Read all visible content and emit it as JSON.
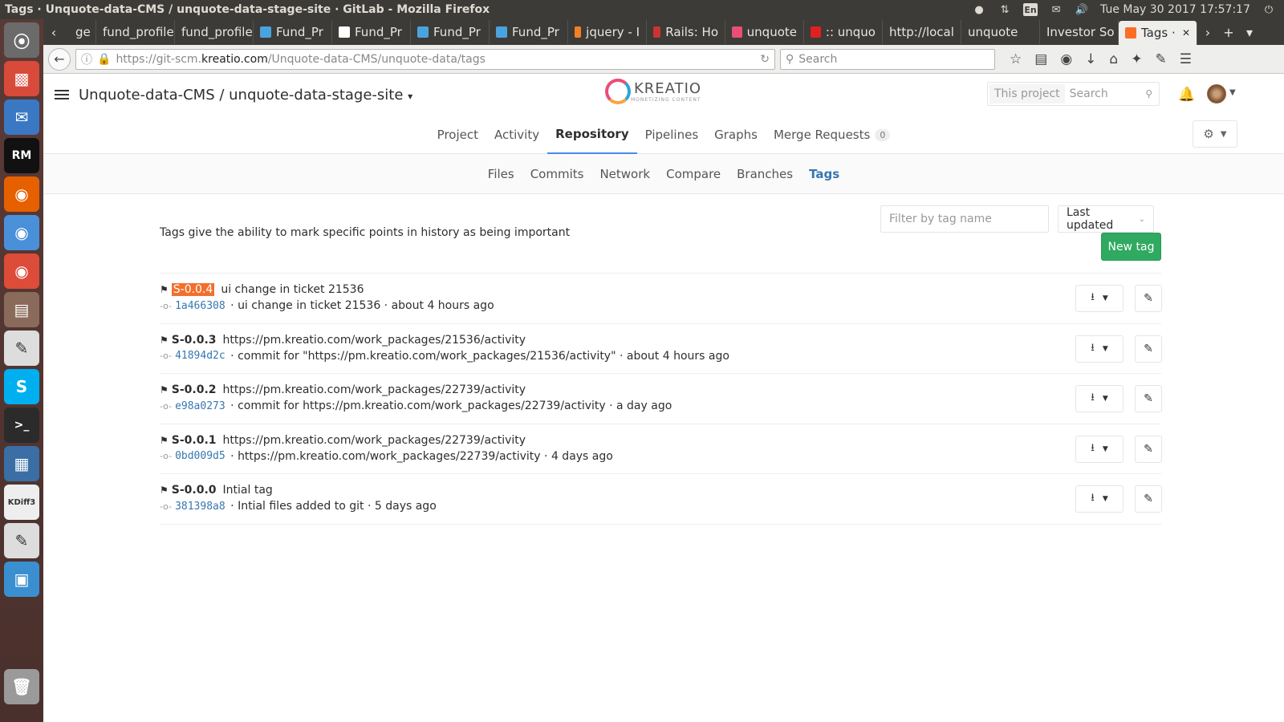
{
  "os": {
    "window_title": "Tags · Unquote-data-CMS / unquote-data-stage-site · GitLab - Mozilla Firefox",
    "lang": "En",
    "datetime": "Tue May 30 2017 17:57:17"
  },
  "browser": {
    "tabs": [
      {
        "label": "ge",
        "fav": "#888"
      },
      {
        "label": "fund_profile",
        "fav": ""
      },
      {
        "label": "fund_profile",
        "fav": ""
      },
      {
        "label": "Fund_Pr",
        "fav": "#4aa3df"
      },
      {
        "label": "Fund_Pr",
        "fav": "#ffffff"
      },
      {
        "label": "Fund_Pr",
        "fav": "#4aa3df"
      },
      {
        "label": "Fund_Pr",
        "fav": "#4aa3df"
      },
      {
        "label": "jquery - I",
        "fav": "#f48024"
      },
      {
        "label": "Rails: Ho",
        "fav": "#cc3333"
      },
      {
        "label": "unquote",
        "fav": "#e94e77"
      },
      {
        "label": ":: unquo",
        "fav": "#e02020"
      },
      {
        "label": "http://local",
        "fav": ""
      },
      {
        "label": "unquote",
        "fav": ""
      },
      {
        "label": "Investor So",
        "fav": ""
      },
      {
        "label": "Tags ·",
        "fav": "#fc6d26"
      }
    ],
    "url_prefix": "https://git-scm.",
    "url_host": "kreatio.com",
    "url_path": "/Unquote-data-CMS/unquote-data/tags",
    "search_placeholder": "Search"
  },
  "header": {
    "project_path": "Unquote-data-CMS / unquote-data-stage-site",
    "brand": "KREATIO",
    "tagline": "MONETIZING CONTENT",
    "search_scope": "This project",
    "search_placeholder": "Search"
  },
  "primary_nav": {
    "items": [
      "Project",
      "Activity",
      "Repository",
      "Pipelines",
      "Graphs",
      "Merge Requests"
    ],
    "merge_count": "0"
  },
  "secondary_nav": {
    "items": [
      "Files",
      "Commits",
      "Network",
      "Compare",
      "Branches",
      "Tags"
    ]
  },
  "tags_page": {
    "intro": "Tags give the ability to mark specific points in history as being important",
    "filter_placeholder": "Filter by tag name",
    "sort_label": "Last updated",
    "new_tag_label": "New tag",
    "tags": [
      {
        "name": "S-0.0.4",
        "message": "ui change in ticket 21536",
        "sha": "1a466308",
        "commit_msg": "ui change in ticket 21536",
        "time": "about 4 hours ago"
      },
      {
        "name": "S-0.0.3",
        "message": "https://pm.kreatio.com/work_packages/21536/activity",
        "sha": "41894d2c",
        "commit_msg": "commit for \"https://pm.kreatio.com/work_packages/21536/activity\"",
        "time": "about 4 hours ago"
      },
      {
        "name": "S-0.0.2",
        "message": "https://pm.kreatio.com/work_packages/22739/activity",
        "sha": "e98a0273",
        "commit_msg": "commit for https://pm.kreatio.com/work_packages/22739/activity",
        "time": "a day ago"
      },
      {
        "name": "S-0.0.1",
        "message": "https://pm.kreatio.com/work_packages/22739/activity",
        "sha": "0bd009d5",
        "commit_msg": "https://pm.kreatio.com/work_packages/22739/activity",
        "time": "4 days ago"
      },
      {
        "name": "S-0.0.0",
        "message": "Intial tag",
        "sha": "381398a8",
        "commit_msg": "Intial files added to git",
        "time": "5 days ago"
      }
    ]
  },
  "colors": {
    "accent": "#3777b0",
    "new_tag": "#2faa60",
    "highlight": "#f26f2c"
  }
}
